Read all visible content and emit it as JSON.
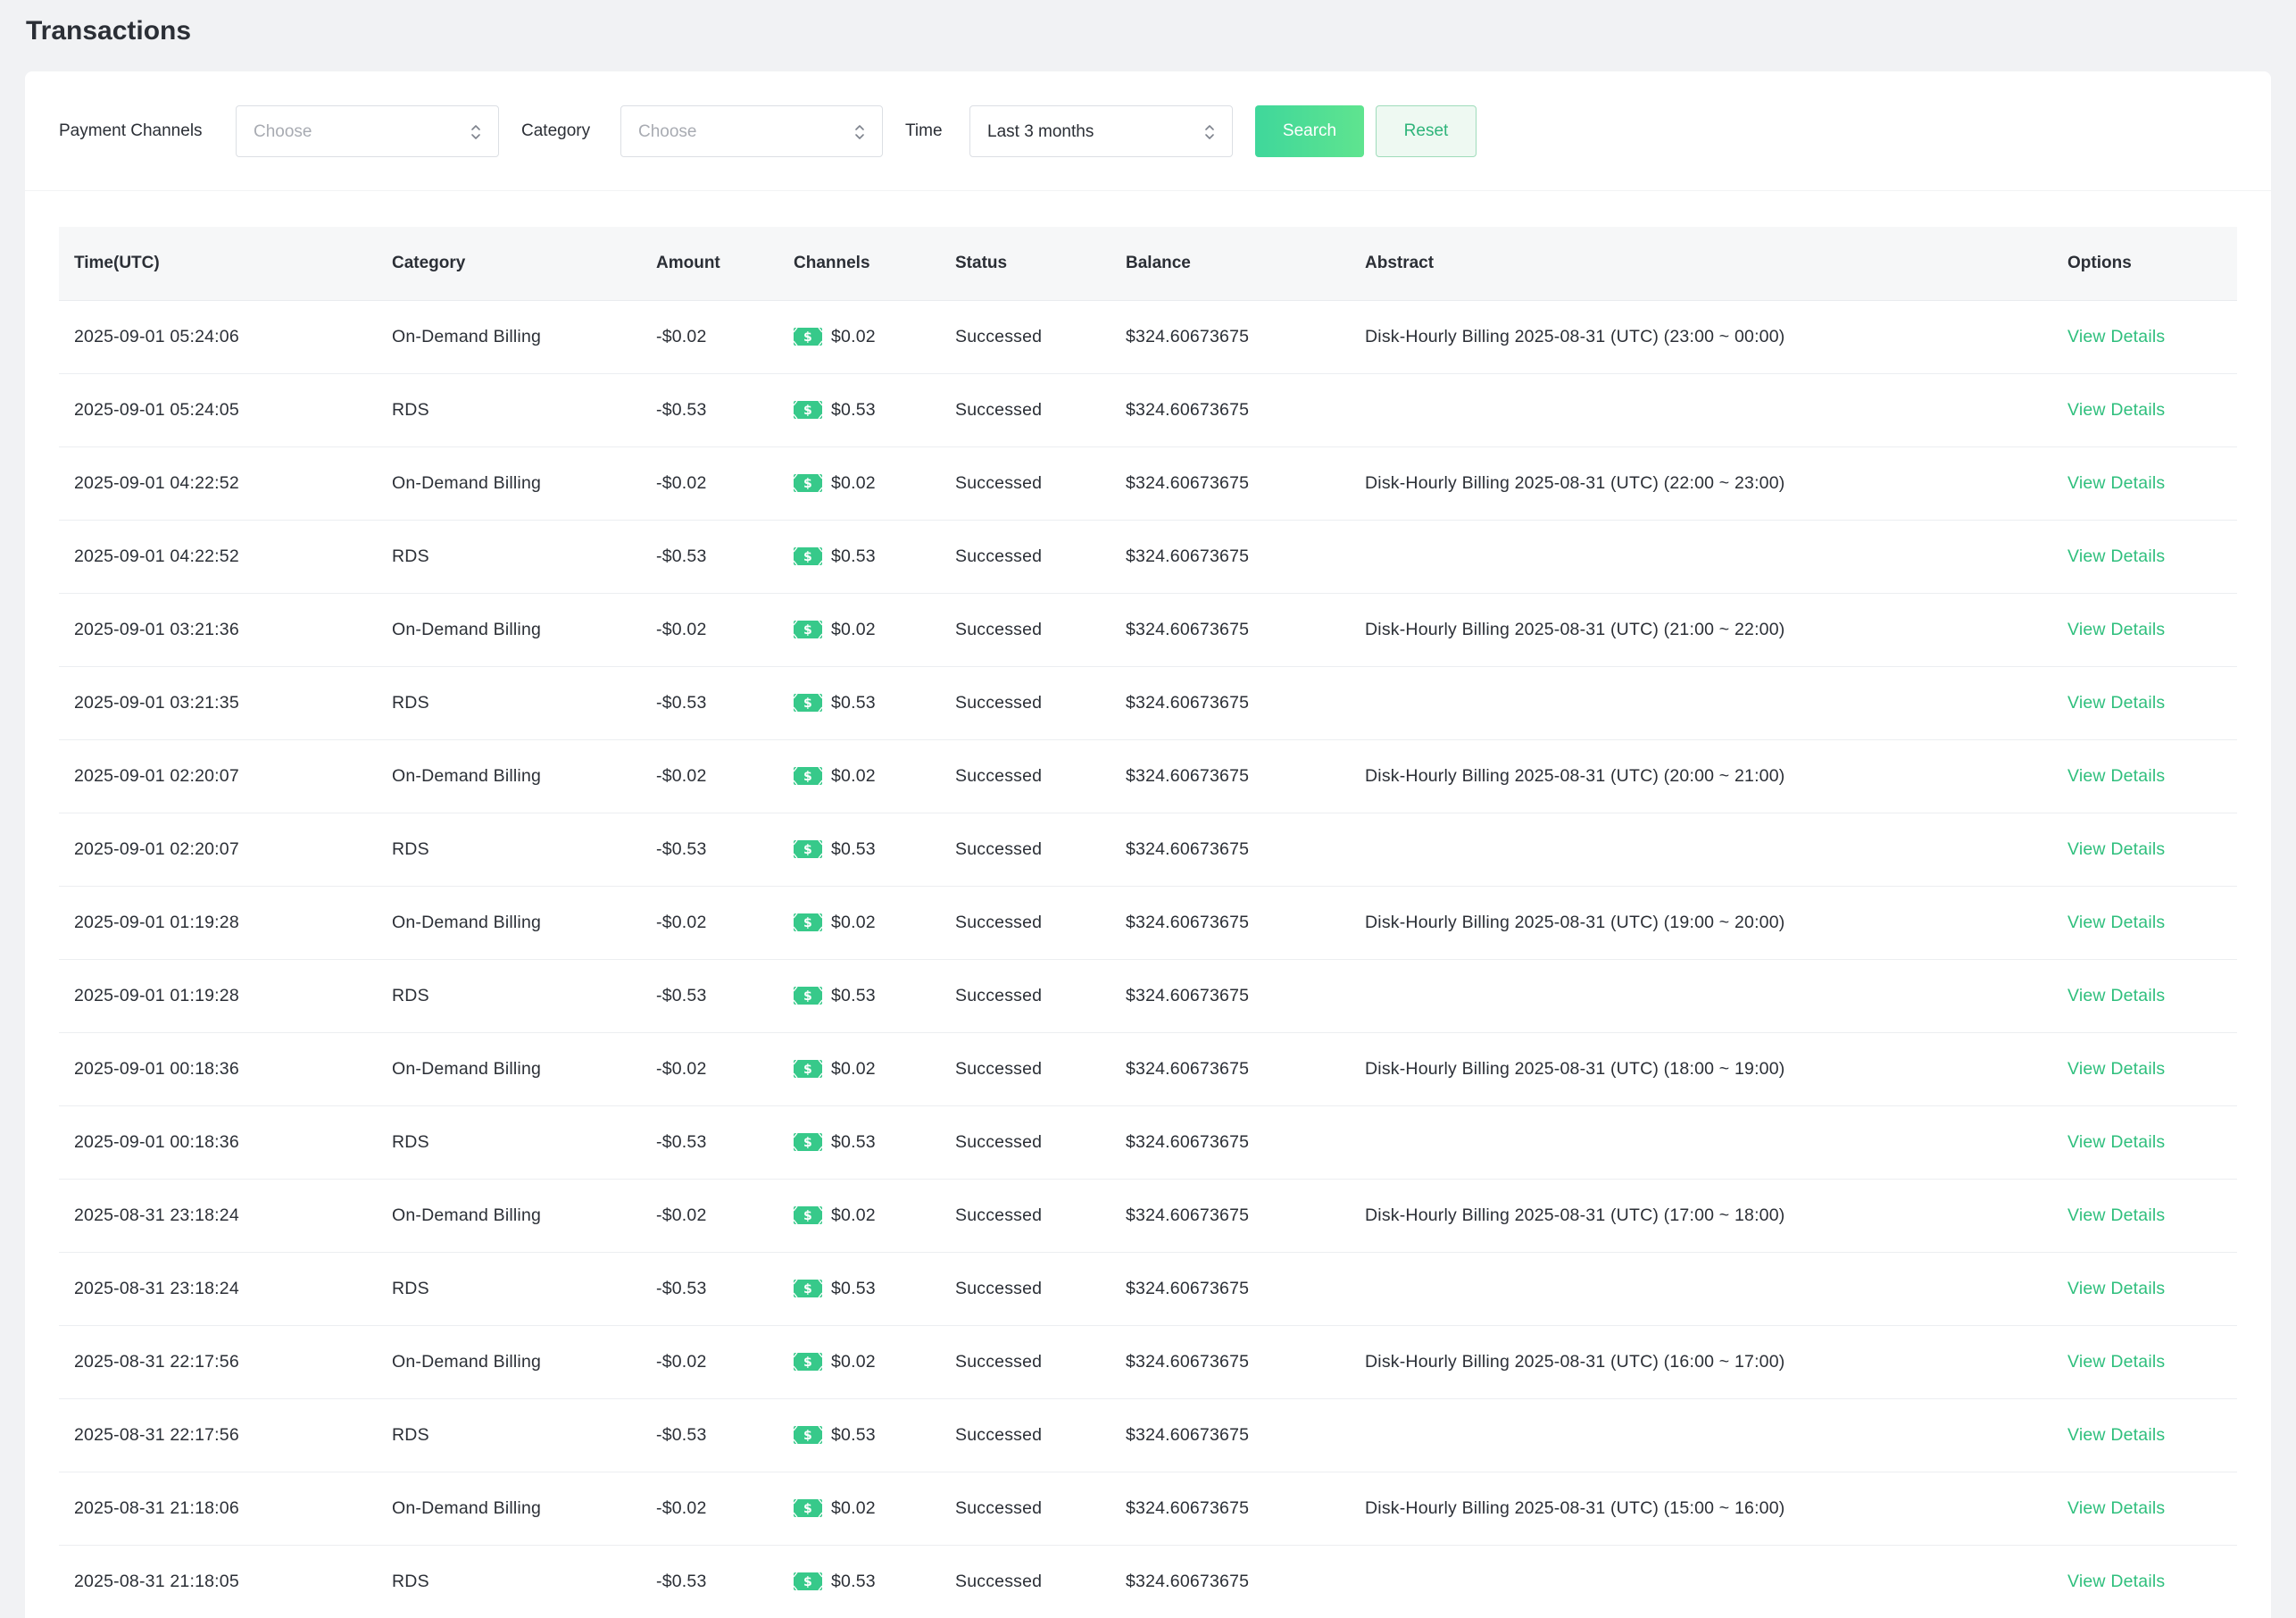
{
  "page": {
    "title": "Transactions"
  },
  "filters": {
    "payment_channels": {
      "label": "Payment Channels",
      "placeholder": "Choose"
    },
    "category": {
      "label": "Category",
      "placeholder": "Choose"
    },
    "time": {
      "label": "Time",
      "value": "Last 3 months"
    },
    "search_label": "Search",
    "reset_label": "Reset"
  },
  "colors": {
    "accent": "#2fbf7d",
    "button_gradient_start": "#3fd79b",
    "button_gradient_end": "#5fe48f",
    "channel_icon": "#37c98a"
  },
  "icons": {
    "select_caret": "chevron-up-down-icon",
    "channel": "dollar-bill-icon"
  },
  "table": {
    "columns": [
      "Time(UTC)",
      "Category",
      "Amount",
      "Channels",
      "Status",
      "Balance",
      "Abstract",
      "Options"
    ],
    "rows": [
      {
        "time": "2025-09-01 05:24:06",
        "category": "On-Demand Billing",
        "amount": "-$0.02",
        "channel_amount": "$0.02",
        "status": "Successed",
        "balance": "$324.60673675",
        "abstract": "Disk-Hourly Billing 2025-08-31 (UTC) (23:00 ~ 00:00)",
        "option": "View Details"
      },
      {
        "time": "2025-09-01 05:24:05",
        "category": "RDS",
        "amount": "-$0.53",
        "channel_amount": "$0.53",
        "status": "Successed",
        "balance": "$324.60673675",
        "abstract": "",
        "option": "View Details"
      },
      {
        "time": "2025-09-01 04:22:52",
        "category": "On-Demand Billing",
        "amount": "-$0.02",
        "channel_amount": "$0.02",
        "status": "Successed",
        "balance": "$324.60673675",
        "abstract": "Disk-Hourly Billing 2025-08-31 (UTC) (22:00 ~ 23:00)",
        "option": "View Details"
      },
      {
        "time": "2025-09-01 04:22:52",
        "category": "RDS",
        "amount": "-$0.53",
        "channel_amount": "$0.53",
        "status": "Successed",
        "balance": "$324.60673675",
        "abstract": "",
        "option": "View Details"
      },
      {
        "time": "2025-09-01 03:21:36",
        "category": "On-Demand Billing",
        "amount": "-$0.02",
        "channel_amount": "$0.02",
        "status": "Successed",
        "balance": "$324.60673675",
        "abstract": "Disk-Hourly Billing 2025-08-31 (UTC) (21:00 ~ 22:00)",
        "option": "View Details"
      },
      {
        "time": "2025-09-01 03:21:35",
        "category": "RDS",
        "amount": "-$0.53",
        "channel_amount": "$0.53",
        "status": "Successed",
        "balance": "$324.60673675",
        "abstract": "",
        "option": "View Details"
      },
      {
        "time": "2025-09-01 02:20:07",
        "category": "On-Demand Billing",
        "amount": "-$0.02",
        "channel_amount": "$0.02",
        "status": "Successed",
        "balance": "$324.60673675",
        "abstract": "Disk-Hourly Billing 2025-08-31 (UTC) (20:00 ~ 21:00)",
        "option": "View Details"
      },
      {
        "time": "2025-09-01 02:20:07",
        "category": "RDS",
        "amount": "-$0.53",
        "channel_amount": "$0.53",
        "status": "Successed",
        "balance": "$324.60673675",
        "abstract": "",
        "option": "View Details"
      },
      {
        "time": "2025-09-01 01:19:28",
        "category": "On-Demand Billing",
        "amount": "-$0.02",
        "channel_amount": "$0.02",
        "status": "Successed",
        "balance": "$324.60673675",
        "abstract": "Disk-Hourly Billing 2025-08-31 (UTC) (19:00 ~ 20:00)",
        "option": "View Details"
      },
      {
        "time": "2025-09-01 01:19:28",
        "category": "RDS",
        "amount": "-$0.53",
        "channel_amount": "$0.53",
        "status": "Successed",
        "balance": "$324.60673675",
        "abstract": "",
        "option": "View Details"
      },
      {
        "time": "2025-09-01 00:18:36",
        "category": "On-Demand Billing",
        "amount": "-$0.02",
        "channel_amount": "$0.02",
        "status": "Successed",
        "balance": "$324.60673675",
        "abstract": "Disk-Hourly Billing 2025-08-31 (UTC) (18:00 ~ 19:00)",
        "option": "View Details"
      },
      {
        "time": "2025-09-01 00:18:36",
        "category": "RDS",
        "amount": "-$0.53",
        "channel_amount": "$0.53",
        "status": "Successed",
        "balance": "$324.60673675",
        "abstract": "",
        "option": "View Details"
      },
      {
        "time": "2025-08-31 23:18:24",
        "category": "On-Demand Billing",
        "amount": "-$0.02",
        "channel_amount": "$0.02",
        "status": "Successed",
        "balance": "$324.60673675",
        "abstract": "Disk-Hourly Billing 2025-08-31 (UTC) (17:00 ~ 18:00)",
        "option": "View Details"
      },
      {
        "time": "2025-08-31 23:18:24",
        "category": "RDS",
        "amount": "-$0.53",
        "channel_amount": "$0.53",
        "status": "Successed",
        "balance": "$324.60673675",
        "abstract": "",
        "option": "View Details"
      },
      {
        "time": "2025-08-31 22:17:56",
        "category": "On-Demand Billing",
        "amount": "-$0.02",
        "channel_amount": "$0.02",
        "status": "Successed",
        "balance": "$324.60673675",
        "abstract": "Disk-Hourly Billing 2025-08-31 (UTC) (16:00 ~ 17:00)",
        "option": "View Details"
      },
      {
        "time": "2025-08-31 22:17:56",
        "category": "RDS",
        "amount": "-$0.53",
        "channel_amount": "$0.53",
        "status": "Successed",
        "balance": "$324.60673675",
        "abstract": "",
        "option": "View Details"
      },
      {
        "time": "2025-08-31 21:18:06",
        "category": "On-Demand Billing",
        "amount": "-$0.02",
        "channel_amount": "$0.02",
        "status": "Successed",
        "balance": "$324.60673675",
        "abstract": "Disk-Hourly Billing 2025-08-31 (UTC) (15:00 ~ 16:00)",
        "option": "View Details"
      },
      {
        "time": "2025-08-31 21:18:05",
        "category": "RDS",
        "amount": "-$0.53",
        "channel_amount": "$0.53",
        "status": "Successed",
        "balance": "$324.60673675",
        "abstract": "",
        "option": "View Details"
      }
    ]
  }
}
